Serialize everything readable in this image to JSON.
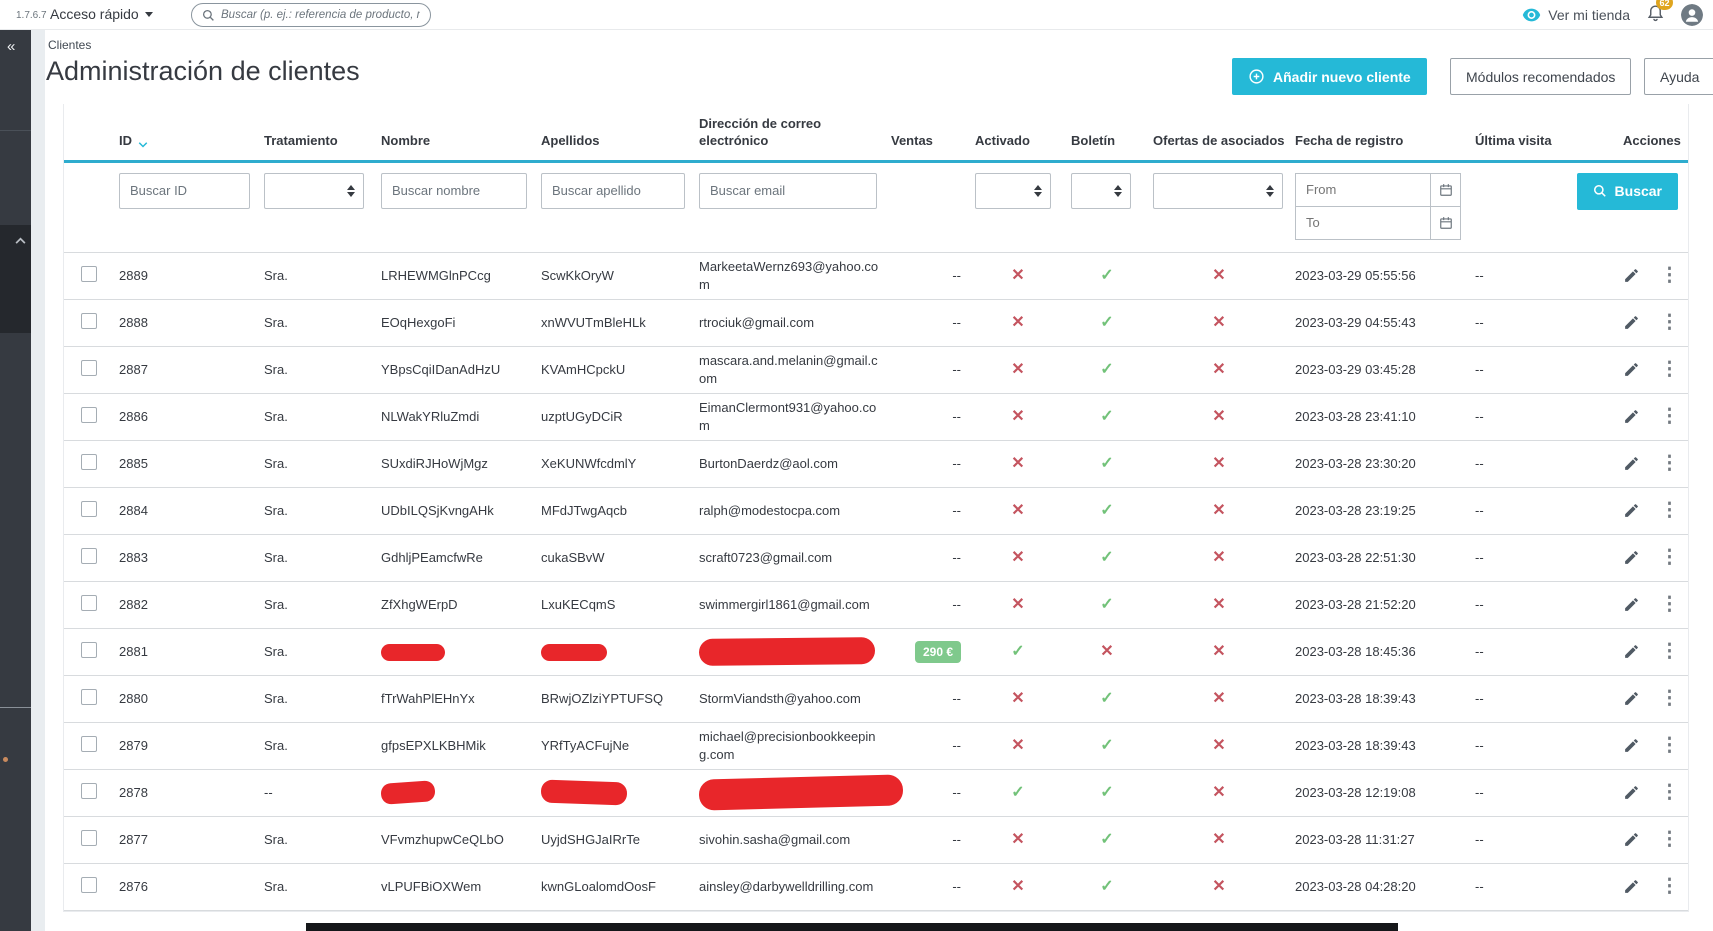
{
  "topbar": {
    "version": "1.7.6.7",
    "quick_access": "Acceso rápido",
    "search_placeholder": "Buscar (p. ej.: referencia de producto, n",
    "view_shop": "Ver mi tienda",
    "notifications_count": "62"
  },
  "breadcrumb": "Clientes",
  "page": {
    "title": "Administración de clientes",
    "add_button": "Añadir nuevo cliente",
    "modules_button": "Módulos recomendados",
    "help_button": "Ayuda"
  },
  "icons": {
    "collapse_sidebar": "«",
    "kebab": "⋮",
    "check": "✓",
    "cross": "✕"
  },
  "colors": {
    "primary": "#25b9d7",
    "header_underline": "#2eacce",
    "success": "#72c279",
    "danger": "#c4545f",
    "sales_badge": "#7fc98c",
    "notification_badge": "#dfa51f",
    "redaction": "#e8262a",
    "sidebar": "#363a41"
  },
  "table": {
    "columns": [
      "ID",
      "Tratamiento",
      "Nombre",
      "Apellidos",
      "Dirección de correo electrónico",
      "Ventas",
      "Activado",
      "Boletín",
      "Ofertas de asociados",
      "Fecha de registro",
      "Última visita",
      "Acciones"
    ],
    "filters": {
      "id_placeholder": "Buscar ID",
      "name_placeholder": "Buscar nombre",
      "lastname_placeholder": "Buscar apellido",
      "email_placeholder": "Buscar email",
      "date_from_placeholder": "From",
      "date_to_placeholder": "To",
      "search_button": "Buscar"
    },
    "rows": [
      {
        "id": "2889",
        "treatment": "Sra.",
        "firstname": "LRHEWMGlnPCcg",
        "lastname": "ScwKkOryW",
        "email": "MarkeetaWernz693@yahoo.com",
        "sales": "--",
        "active": false,
        "newsletter": true,
        "partner": false,
        "registration": "2023-03-29 05:55:56",
        "last_visit": "--"
      },
      {
        "id": "2888",
        "treatment": "Sra.",
        "firstname": "EOqHexgoFi",
        "lastname": "xnWVUTmBleHLk",
        "email": "rtrociuk@gmail.com",
        "sales": "--",
        "active": false,
        "newsletter": true,
        "partner": false,
        "registration": "2023-03-29 04:55:43",
        "last_visit": "--"
      },
      {
        "id": "2887",
        "treatment": "Sra.",
        "firstname": "YBpsCqiIDanAdHzU",
        "lastname": "KVAmHCpckU",
        "email": "mascara.and.melanin@gmail.com",
        "sales": "--",
        "active": false,
        "newsletter": true,
        "partner": false,
        "registration": "2023-03-29 03:45:28",
        "last_visit": "--"
      },
      {
        "id": "2886",
        "treatment": "Sra.",
        "firstname": "NLWakYRluZmdi",
        "lastname": "uzptUGyDCiR",
        "email": "EimanClermont931@yahoo.com",
        "sales": "--",
        "active": false,
        "newsletter": true,
        "partner": false,
        "registration": "2023-03-28 23:41:10",
        "last_visit": "--"
      },
      {
        "id": "2885",
        "treatment": "Sra.",
        "firstname": "SUxdiRJHoWjMgz",
        "lastname": "XeKUNWfcdmlY",
        "email": "BurtonDaerdz@aol.com",
        "sales": "--",
        "active": false,
        "newsletter": true,
        "partner": false,
        "registration": "2023-03-28 23:30:20",
        "last_visit": "--"
      },
      {
        "id": "2884",
        "treatment": "Sra.",
        "firstname": "UDbILQSjKvngAHk",
        "lastname": "MFdJTwgAqcb",
        "email": "ralph@modestocpa.com",
        "sales": "--",
        "active": false,
        "newsletter": true,
        "partner": false,
        "registration": "2023-03-28 23:19:25",
        "last_visit": "--"
      },
      {
        "id": "2883",
        "treatment": "Sra.",
        "firstname": "GdhljPEamcfwRe",
        "lastname": "cukaSBvW",
        "email": "scraft0723@gmail.com",
        "sales": "--",
        "active": false,
        "newsletter": true,
        "partner": false,
        "registration": "2023-03-28 22:51:30",
        "last_visit": "--"
      },
      {
        "id": "2882",
        "treatment": "Sra.",
        "firstname": "ZfXhgWErpD",
        "lastname": "LxuKECqmS",
        "email": "swimmergirl1861@gmail.com",
        "sales": "--",
        "active": false,
        "newsletter": true,
        "partner": false,
        "registration": "2023-03-28 21:52:20",
        "last_visit": "--"
      },
      {
        "id": "2881",
        "treatment": "Sra.",
        "firstname": null,
        "lastname": null,
        "email": null,
        "sales": "290 €",
        "active": true,
        "newsletter": false,
        "partner": false,
        "registration": "2023-03-28 18:45:36",
        "last_visit": "--"
      },
      {
        "id": "2880",
        "treatment": "Sra.",
        "firstname": "fTrWahPlEHnYx",
        "lastname": "BRwjOZlziYPTUFSQ",
        "email": "StormViandsth@yahoo.com",
        "sales": "--",
        "active": false,
        "newsletter": true,
        "partner": false,
        "registration": "2023-03-28 18:39:43",
        "last_visit": "--"
      },
      {
        "id": "2879",
        "treatment": "Sra.",
        "firstname": "gfpsEPXLKBHMik",
        "lastname": "YRfTyACFujNe",
        "email": "michael@precisionbookkeeping.com",
        "sales": "--",
        "active": false,
        "newsletter": true,
        "partner": false,
        "registration": "2023-03-28 18:39:43",
        "last_visit": "--"
      },
      {
        "id": "2878",
        "treatment": "--",
        "firstname": null,
        "lastname": null,
        "email": null,
        "sales": "--",
        "active": true,
        "newsletter": true,
        "partner": false,
        "registration": "2023-03-28 12:19:08",
        "last_visit": "--"
      },
      {
        "id": "2877",
        "treatment": "Sra.",
        "firstname": "VFvmzhupwCeQLbO",
        "lastname": "UyjdSHGJaIRrTe",
        "email": "sivohin.sasha@gmail.com",
        "sales": "--",
        "active": false,
        "newsletter": true,
        "partner": false,
        "registration": "2023-03-28 11:31:27",
        "last_visit": "--"
      },
      {
        "id": "2876",
        "treatment": "Sra.",
        "firstname": "vLPUFBiOXWem",
        "lastname": "kwnGLoalomdOosF",
        "email": "ainsley@darbywelldrilling.com",
        "sales": "--",
        "active": false,
        "newsletter": true,
        "partner": false,
        "registration": "2023-03-28 04:28:20",
        "last_visit": "--"
      }
    ]
  }
}
